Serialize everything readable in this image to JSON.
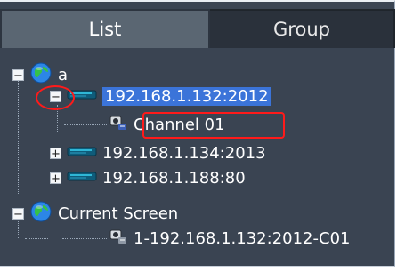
{
  "tabs": {
    "list_label": "List",
    "group_label": "Group"
  },
  "tree": {
    "root_a": {
      "label": "a"
    },
    "device1": {
      "label": "192.168.1.132:2012",
      "child": {
        "label": "Channel 01"
      }
    },
    "device2": {
      "label": "192.168.1.134:2013"
    },
    "device3": {
      "label": "192.168.1.188:80"
    },
    "current_screen": {
      "label": "Current Screen",
      "child": {
        "label": "1-192.168.1.132:2012-C01"
      }
    }
  },
  "expanders": {
    "minus": "−",
    "plus": "+"
  },
  "icons": {
    "globe": "globe-icon",
    "device": "device-icon",
    "camera": "camera-icon"
  },
  "colors": {
    "panel_bg": "#3a4452",
    "tab_active": "#5a6672",
    "tab_inactive": "#2a313b",
    "selection": "#3b74d9",
    "highlight": "#ff1a1a"
  }
}
